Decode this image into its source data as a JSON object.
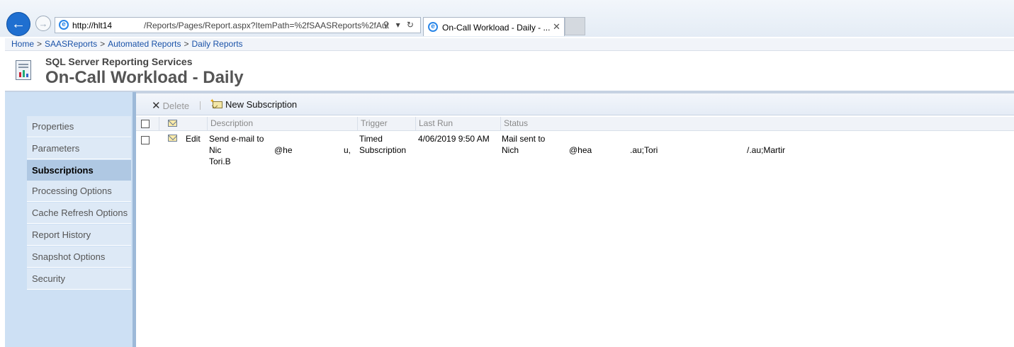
{
  "browser": {
    "back_icon": "back-arrow-icon",
    "forward_icon": "forward-arrow-icon",
    "url_host": "http://hlt14",
    "url_path": "/Reports/Pages/Report.aspx?ItemPath=%2fSAASReports%2fAut",
    "address_icons": "⚲ ▾ ↻",
    "tab_title": "On-Call Workload - Daily - ...",
    "tab_close": "✕"
  },
  "breadcrumb": {
    "items": [
      "Home",
      "SAASReports",
      "Automated Reports",
      "Daily Reports"
    ],
    "separator": ">"
  },
  "header": {
    "app_name": "SQL Server Reporting Services",
    "report_title": "On-Call Workload - Daily"
  },
  "sidebar": {
    "items": [
      {
        "label": "Properties",
        "active": false
      },
      {
        "label": "Parameters",
        "active": false
      },
      {
        "label": "Subscriptions",
        "active": true
      },
      {
        "label": "Processing Options",
        "active": false
      },
      {
        "label": "Cache Refresh Options",
        "active": false
      },
      {
        "label": "Report History",
        "active": false
      },
      {
        "label": "Snapshot Options",
        "active": false
      },
      {
        "label": "Security",
        "active": false
      }
    ]
  },
  "toolbar": {
    "delete_label": "Delete",
    "new_subscription_label": "New Subscription"
  },
  "table": {
    "columns": [
      "Description",
      "Trigger",
      "Last Run",
      "Status"
    ],
    "rows": [
      {
        "edit_label": "Edit",
        "description_lines": [
          "Send e-mail to",
          "Nic",
          "@he",
          "u,",
          "Tori.B"
        ],
        "trigger_lines": [
          "Timed",
          "Subscription"
        ],
        "last_run": "4/06/2019 9:50 AM",
        "status_lines": [
          "Mail sent to",
          "Nich",
          "@hea",
          ".au;Tori",
          "/.au;Martir"
        ]
      }
    ]
  },
  "colors": {
    "link": "#1a52a8",
    "sidebar_bg": "#cde0f4",
    "sidebar_active": "#afc8e3",
    "back_button": "#1f6fd0"
  }
}
